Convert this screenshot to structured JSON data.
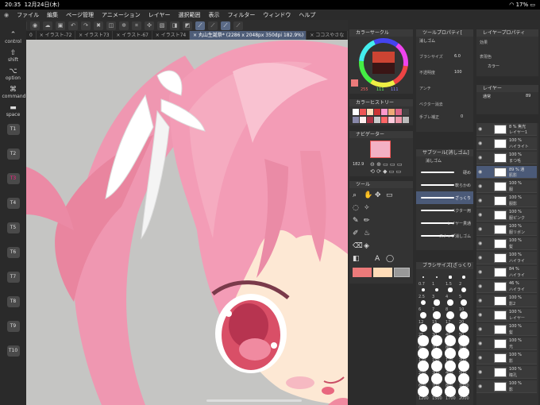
{
  "status": {
    "time": "20:35",
    "date": "12月24日(木)",
    "battery": "17%"
  },
  "menu": [
    "ファイル",
    "編集",
    "ページ管理",
    "アニメーション",
    "レイヤー",
    "選択範囲",
    "表示",
    "フィルター",
    "ウィンドウ",
    "ヘルプ"
  ],
  "tabs": [
    {
      "label": "0"
    },
    {
      "label": "イラスト-72"
    },
    {
      "label": "イラスト73"
    },
    {
      "label": "イラスト-67"
    },
    {
      "label": "イラスト74"
    },
    {
      "label": "丸山生誕祭* (2286 x 2048px 350dpi 182.9%)"
    },
    {
      "label": "ココスやさな"
    }
  ],
  "left_keys": {
    "control": "control",
    "shift": "shift",
    "option": "option",
    "command": "command",
    "space": "space"
  },
  "tkeys": [
    "T1",
    "T2",
    "T3",
    "T4",
    "T5",
    "T6",
    "T7",
    "T8",
    "T9",
    "T10"
  ],
  "panels": {
    "color_circle": "カラーサークル",
    "color_values": {
      "r": "255",
      "g": "111",
      "b": "111"
    },
    "color_history": "カラーヒストリー",
    "navigator": "ナビゲーター",
    "zoom": "182.9",
    "tool": "ツール",
    "tool_property": "ツールプロパティ[",
    "eraser": "消しゴム",
    "brush_size_label": "ブラシサイズ",
    "brush_size": "6.0",
    "opacity_label": "不透明度",
    "opacity": "100",
    "antialias": "アンチ",
    "vector": "ベクター消去",
    "stabilize": "手ブレ補正",
    "stabilize_value": "0",
    "subtool": "サブツール[消しゴム]",
    "subtool_group": "消しゴム",
    "brushes": [
      "硬め",
      "軟らかめ",
      "ざっくり",
      "ベクター用",
      "レイヤー貫通",
      "スナップ消しゴム"
    ],
    "brush_sizes_title": "ブラシサイズ[ざっくり",
    "size_values": [
      "0.7",
      "1",
      "1.5",
      "2",
      "2.5",
      "3",
      "4",
      "5",
      "6",
      "7",
      "8",
      "10",
      "12",
      "15",
      "17",
      "20",
      "25",
      "30",
      "40",
      "50",
      "60",
      "70",
      "80",
      "100",
      "120",
      "150",
      "170",
      "200",
      "250",
      "300",
      "400",
      "500",
      "600",
      "700",
      "800",
      "1000",
      "1200",
      "1500",
      "1700",
      "2000"
    ],
    "layer_property": "レイヤープロパティ",
    "effect_label": "効果",
    "expression_color": "表現色",
    "color_mode": "カラー",
    "layer_title": "レイヤー",
    "blend_mode": "通常",
    "layer_opacity": "89"
  },
  "layers": [
    {
      "pct": "8 % 焦光",
      "name": "レイヤー1"
    },
    {
      "pct": "100 %",
      "name": "ハイライト"
    },
    {
      "pct": "100 %",
      "name": "まつ毛"
    },
    {
      "pct": "89 % 通",
      "name": "肌影"
    },
    {
      "pct": "100 %",
      "name": "服"
    },
    {
      "pct": "100 %",
      "name": "服影"
    },
    {
      "pct": "100 %",
      "name": "服ピンク"
    },
    {
      "pct": "100 %",
      "name": "服リボン"
    },
    {
      "pct": "100 %",
      "name": "髪"
    },
    {
      "pct": "100 %",
      "name": "ハイライ"
    },
    {
      "pct": "84 %",
      "name": "ハイライ"
    },
    {
      "pct": "46 %",
      "name": "ハイライ"
    },
    {
      "pct": "100 %",
      "name": "影2"
    },
    {
      "pct": "100 %",
      "name": "レイヤー"
    },
    {
      "pct": "100 %",
      "name": "髪"
    },
    {
      "pct": "100 %",
      "name": "光"
    },
    {
      "pct": "100 %",
      "name": "影"
    },
    {
      "pct": "100 %",
      "name": "瞳孔"
    },
    {
      "pct": "100 %",
      "name": "影"
    }
  ],
  "colors": {
    "main": "#ec7a7a",
    "sub": "#ffdcb8",
    "hair": "#f19bb4",
    "accent": "#5a6a86"
  }
}
